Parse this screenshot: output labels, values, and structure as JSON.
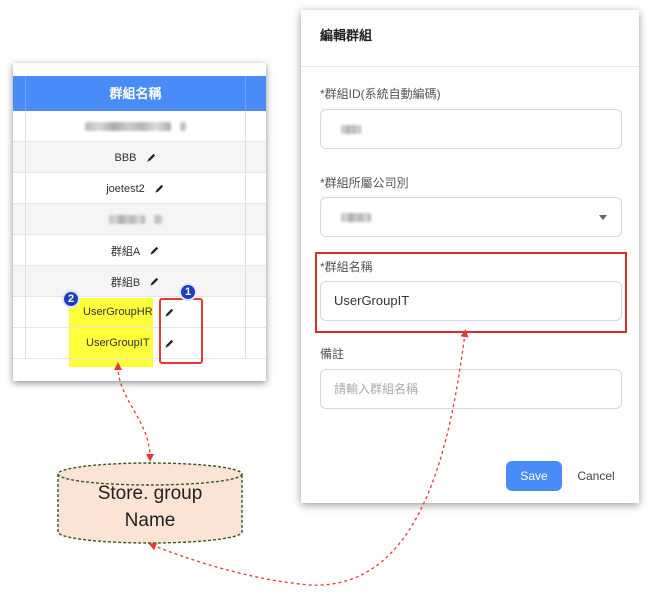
{
  "table": {
    "header": "群組名稱",
    "rows": [
      {
        "name": ""
      },
      {
        "name": "BBB"
      },
      {
        "name": "joetest2"
      },
      {
        "name": ""
      },
      {
        "name": "群組A"
      },
      {
        "name": "群組B"
      },
      {
        "name": "UserGroupHR"
      },
      {
        "name": "UserGroupIT"
      }
    ]
  },
  "badges": {
    "one": "1",
    "two": "2"
  },
  "dialog": {
    "title": "編輯群組",
    "group_id_label": "*群組ID(系統自動編碼)",
    "company_label": "*群組所屬公司別",
    "name_label": "*群組名稱",
    "name_value": "UserGroupIT",
    "note_label": "備註",
    "note_placeholder": "請輸入群組名稱",
    "save_label": "Save",
    "cancel_label": "Cancel"
  },
  "store": {
    "line1": "Store. group",
    "line2": "Name"
  },
  "colors": {
    "header_blue": "#4a8cf7",
    "highlight_yellow": "#ffff3a",
    "annotation_red": "#e53935",
    "badge_blue": "#1f3fb8",
    "store_fill": "#fbe3d6"
  },
  "icons": [
    "pencil-icon",
    "chevron-down-icon"
  ]
}
